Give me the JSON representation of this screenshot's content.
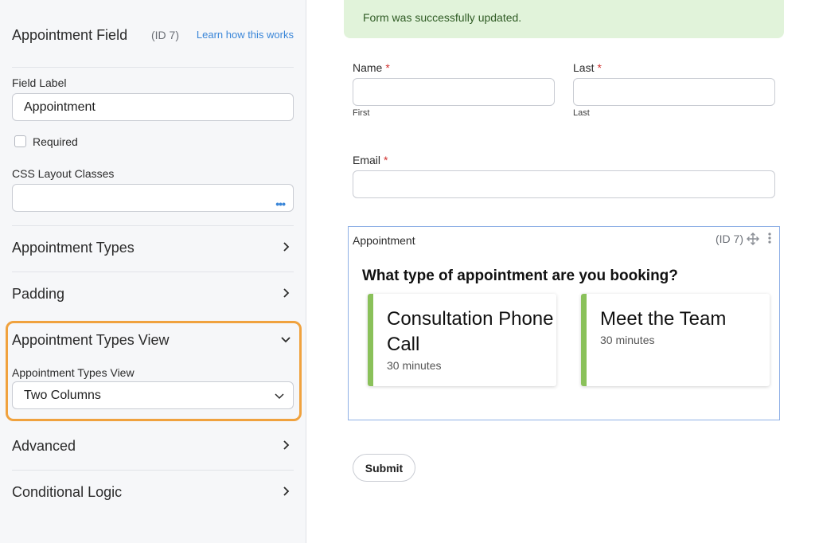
{
  "sidebar": {
    "title": "Appointment Field",
    "id_label": "(ID 7)",
    "learn_link": "Learn how this works",
    "field_label": {
      "label": "Field Label",
      "value": "Appointment"
    },
    "required_label": "Required",
    "css_classes": {
      "label": "CSS Layout Classes",
      "value": "",
      "more_icon": "ellipsis-icon"
    },
    "sections": [
      {
        "label": "Appointment Types",
        "icon": "chevron-right-icon"
      },
      {
        "label": "Padding",
        "icon": "chevron-right-icon"
      },
      {
        "label": "Appointment Types View",
        "icon": "chevron-down-icon"
      },
      {
        "label": "Advanced",
        "icon": "chevron-right-icon"
      },
      {
        "label": "Conditional Logic",
        "icon": "chevron-right-icon"
      }
    ],
    "types_view": {
      "label": "Appointment Types View",
      "value": "Two Columns"
    },
    "highlight_color": "#f0a23e"
  },
  "main": {
    "alert": "Form was successfully updated.",
    "name": {
      "label": "Name",
      "required_mark": "*",
      "first_sub": "First"
    },
    "last": {
      "label": "Last",
      "required_mark": "*",
      "sub": "Last"
    },
    "email": {
      "label": "Email",
      "required_mark": "*"
    },
    "appointment": {
      "label": "Appointment",
      "id_label": "(ID 7)",
      "question": "What type of appointment are you booking?",
      "cards": [
        {
          "title": "Consultation Phone Call",
          "duration": "30 minutes"
        },
        {
          "title": "Meet the Team",
          "duration": "30 minutes"
        }
      ],
      "accent_color": "#8ac15a"
    },
    "submit_label": "Submit"
  }
}
